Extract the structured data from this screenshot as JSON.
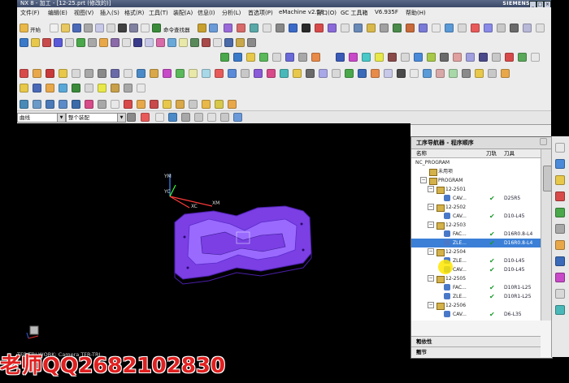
{
  "window": {
    "title": "NX 8 - 加工 - [12-25.prt (修改的)]",
    "brand": "SIEMENS",
    "controls": [
      "_",
      "□",
      "×"
    ]
  },
  "menubar": {
    "items": [
      "文件(F)",
      "编辑(E)",
      "视图(V)",
      "插入(S)",
      "格式(R)",
      "工具(T)",
      "装配(A)",
      "信息(I)",
      "分析(L)",
      "首选项(P)",
      "eMachine v2.58",
      "窗口(O)",
      "GC 工具箱",
      "V6.935F",
      "帮助(H)"
    ]
  },
  "toolbar": {
    "start_label": "开始",
    "cmd_finder": "命令查找器"
  },
  "selection_bar": {
    "filter_value": "曲线",
    "scope_value": "整个装配"
  },
  "viewport": {
    "triad_y": "YM",
    "triad_y2": "YC",
    "triad_x": "XC",
    "triad_x2": "XM",
    "status_text": "TFR-TRI WORK: Camera TFR-TRI"
  },
  "navigator": {
    "title": "工序导航器 - 程序顺序",
    "col_name": "名称",
    "col_toolpath": "刀轨",
    "col_tool": "刀具",
    "rows": [
      {
        "label": "NC_PROGRAM",
        "level": 0,
        "type": "text",
        "check": false,
        "tool": ""
      },
      {
        "label": "未用项",
        "level": 1,
        "type": "folder",
        "check": false,
        "tool": ""
      },
      {
        "label": "PROGRAM",
        "level": 1,
        "type": "folder",
        "check": false,
        "tool": "",
        "expand": "−"
      },
      {
        "label": "12-2501",
        "level": 2,
        "type": "folder",
        "check": false,
        "tool": "",
        "expand": "−"
      },
      {
        "label": "CAV...",
        "level": 3,
        "type": "op",
        "check": true,
        "tool": "D25R5"
      },
      {
        "label": "12-2502",
        "level": 2,
        "type": "folder",
        "check": false,
        "tool": "",
        "expand": "−"
      },
      {
        "label": "CAV...",
        "level": 3,
        "type": "op",
        "check": true,
        "tool": "D10-L45"
      },
      {
        "label": "12-2503",
        "level": 2,
        "type": "folder",
        "check": false,
        "tool": "",
        "expand": "−"
      },
      {
        "label": "FAC...",
        "level": 3,
        "type": "op",
        "check": true,
        "tool": "D16R0.8-L4"
      },
      {
        "label": "ZLE...",
        "level": 3,
        "type": "op",
        "check": true,
        "tool": "D16R0.8-L4",
        "selected": true
      },
      {
        "label": "12-2504",
        "level": 2,
        "type": "folder",
        "check": false,
        "tool": "",
        "expand": "−"
      },
      {
        "label": "ZLE...",
        "level": 3,
        "type": "op",
        "check": true,
        "tool": "D10-L45"
      },
      {
        "label": "CAV...",
        "level": 3,
        "type": "op",
        "check": true,
        "tool": "D10-L45"
      },
      {
        "label": "12-2505",
        "level": 2,
        "type": "folder",
        "check": false,
        "tool": "",
        "expand": "−"
      },
      {
        "label": "FAC...",
        "level": 3,
        "type": "op",
        "check": true,
        "tool": "D10R1-L25"
      },
      {
        "label": "ZLE...",
        "level": 3,
        "type": "op",
        "check": true,
        "tool": "D10R1-L25"
      },
      {
        "label": "12-2506",
        "level": 2,
        "type": "folder",
        "check": false,
        "tool": "",
        "expand": "−"
      },
      {
        "label": "CAV...",
        "level": 3,
        "type": "op",
        "check": true,
        "tool": "D6-L35"
      }
    ],
    "section_dependencies": "相依性",
    "section_details": "细节"
  },
  "watermark": "老师QQ2682102830",
  "colors": {
    "part": "#7b3fe4",
    "selection": "#3b7fd6",
    "check": "#1a9a2a",
    "watermark": "#e02020"
  }
}
